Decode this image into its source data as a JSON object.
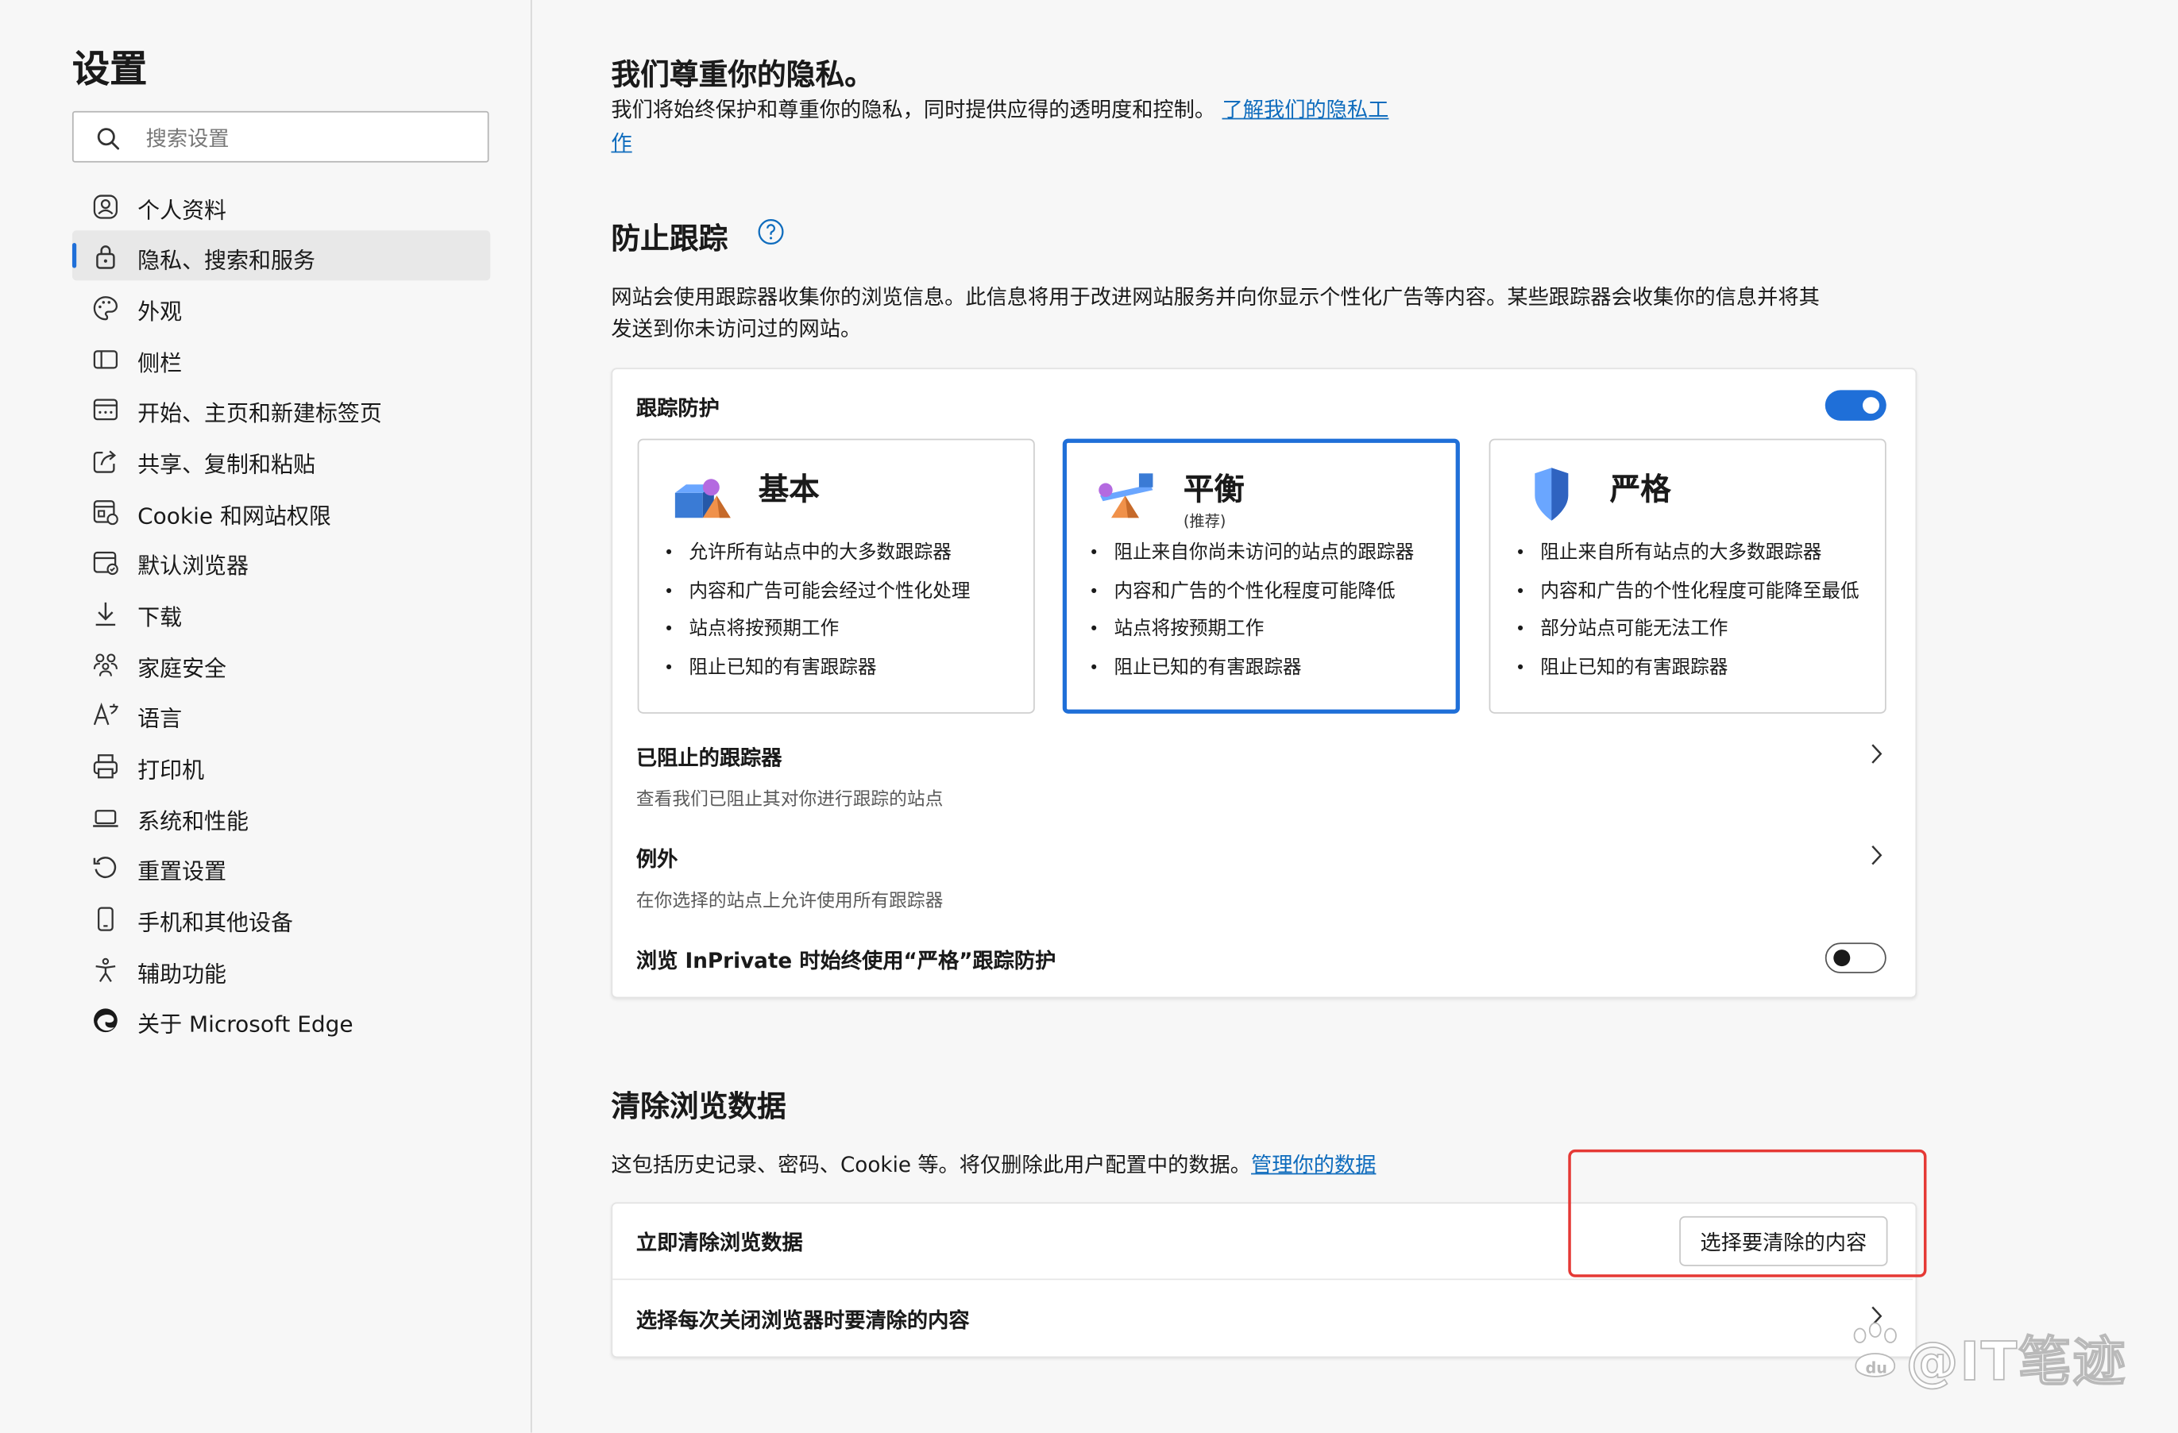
{
  "sidebar": {
    "title": "设置",
    "search_placeholder": "搜索设置",
    "items": [
      {
        "label": "个人资料",
        "icon": "profile-icon"
      },
      {
        "label": "隐私、搜索和服务",
        "icon": "lock-icon",
        "active": true
      },
      {
        "label": "外观",
        "icon": "palette-icon"
      },
      {
        "label": "侧栏",
        "icon": "sidebar-icon"
      },
      {
        "label": "开始、主页和新建标签页",
        "icon": "home-tab-icon"
      },
      {
        "label": "共享、复制和粘贴",
        "icon": "share-icon"
      },
      {
        "label": "Cookie 和网站权限",
        "icon": "cookie-icon"
      },
      {
        "label": "默认浏览器",
        "icon": "browser-icon"
      },
      {
        "label": "下载",
        "icon": "download-icon"
      },
      {
        "label": "家庭安全",
        "icon": "family-icon"
      },
      {
        "label": "语言",
        "icon": "language-icon"
      },
      {
        "label": "打印机",
        "icon": "printer-icon"
      },
      {
        "label": "系统和性能",
        "icon": "system-icon"
      },
      {
        "label": "重置设置",
        "icon": "reset-icon"
      },
      {
        "label": "手机和其他设备",
        "icon": "phone-icon"
      },
      {
        "label": "辅助功能",
        "icon": "accessibility-icon"
      },
      {
        "label": "关于 Microsoft Edge",
        "icon": "edge-logo-icon"
      }
    ]
  },
  "privacy": {
    "title": "我们尊重你的隐私。",
    "desc": "我们将始终保护和尊重你的隐私，同时提供应得的透明度和控制。",
    "link_line1": "了解我们的隐私工",
    "link_line2": "作"
  },
  "tracking": {
    "title": "防止跟踪",
    "help_icon": "help-circle-icon",
    "desc_line1": "网站会使用跟踪器收集你的浏览信息。此信息将用于改进网站服务并向你显示个性化广告等内容。某些跟踪器会收集你的信息并将其",
    "desc_line2": "发送到你未访问过的网站。",
    "card_title": "跟踪防护",
    "toggle_on": true,
    "options": [
      {
        "title": "基本",
        "subtitle": "",
        "selected": false,
        "bullets": [
          "允许所有站点中的大多数跟踪器",
          "内容和广告可能会经过个性化处理",
          "站点将按预期工作",
          "阻止已知的有害跟踪器"
        ]
      },
      {
        "title": "平衡",
        "subtitle": "(推荐)",
        "selected": true,
        "bullets": [
          "阻止来自你尚未访问的站点的跟踪器",
          "内容和广告的个性化程度可能降低",
          "站点将按预期工作",
          "阻止已知的有害跟踪器"
        ]
      },
      {
        "title": "严格",
        "subtitle": "",
        "selected": false,
        "bullets": [
          "阻止来自所有站点的大多数跟踪器",
          "内容和广告的个性化程度可能降至最低",
          "部分站点可能无法工作",
          "阻止已知的有害跟踪器"
        ]
      }
    ],
    "blocked": {
      "title": "已阻止的跟踪器",
      "desc": "查看我们已阻止其对你进行跟踪的站点"
    },
    "exceptions": {
      "title": "例外",
      "desc": "在你选择的站点上允许使用所有跟踪器"
    },
    "inprivate": {
      "label": "浏览 InPrivate 时始终使用“严格”跟踪防护",
      "toggle_on": false
    }
  },
  "clear": {
    "title": "清除浏览数据",
    "desc": "这包括历史记录、密码、Cookie 等。将仅删除此用户配置中的数据。",
    "link": "管理你的数据",
    "now_label": "立即清除浏览数据",
    "button": "选择要清除的内容",
    "on_close_label": "选择每次关闭浏览器时要清除的内容"
  },
  "watermark": "@IT笔迹",
  "colors": {
    "accent": "#1f6fd8",
    "link": "#0f6cbd",
    "highlight": "#e53935"
  }
}
